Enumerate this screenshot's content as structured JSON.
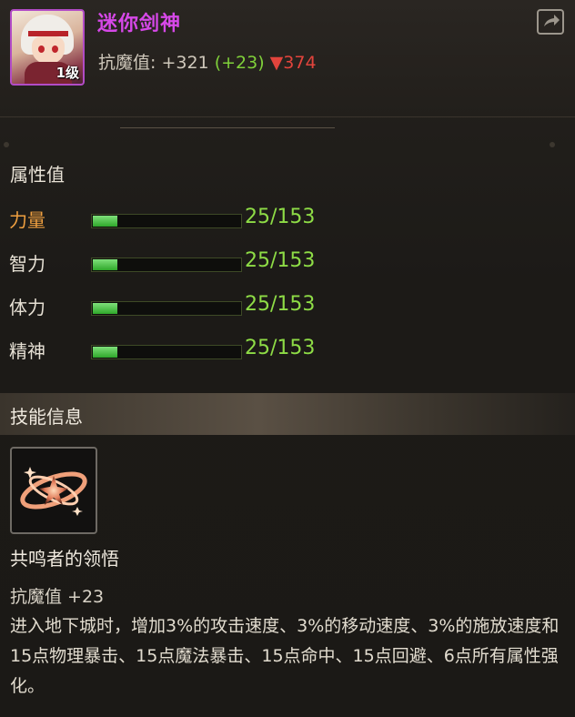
{
  "header": {
    "name": "迷你剑神",
    "level": "1级",
    "resist_label": "抗魔值:",
    "resist_value": "+321",
    "resist_bonus": "(+23)",
    "resist_drop": "374",
    "share_icon": "share-icon"
  },
  "attributes": {
    "title": "属性值",
    "items": [
      {
        "label": "力量",
        "value": "25/153",
        "ratio": 0.163
      },
      {
        "label": "智力",
        "value": "25/153",
        "ratio": 0.163
      },
      {
        "label": "体力",
        "value": "25/153",
        "ratio": 0.163
      },
      {
        "label": "精神",
        "value": "25/153",
        "ratio": 0.163
      }
    ]
  },
  "skill": {
    "section_title": "技能信息",
    "icon": "resonance-swirl-icon",
    "name": "共鸣者的领悟",
    "stat": "抗魔值 +23",
    "description": "进入地下城时，增加3%的攻击速度、3%的移动速度、3%的施放速度和15点物理暴击、15点魔法暴击、15点命中、15点回避、6点所有属性强化。"
  },
  "colors": {
    "title": "#d648e8",
    "value_green": "#8edc46",
    "drop_red": "#e2443c",
    "highlight": "#f0a040"
  }
}
